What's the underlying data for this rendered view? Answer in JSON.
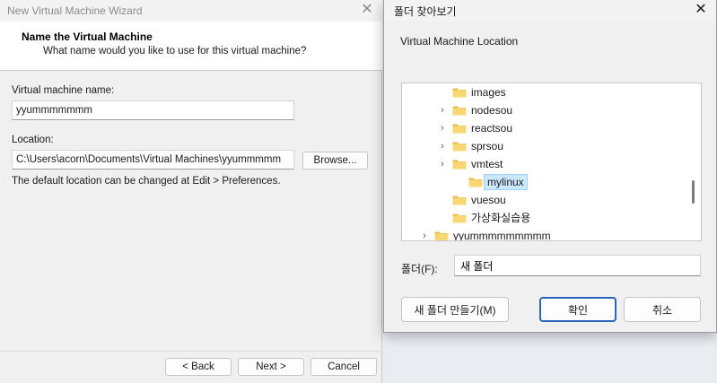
{
  "wizard": {
    "title": "New Virtual Machine Wizard",
    "close_glyph": "✕",
    "header_title": "Name the Virtual Machine",
    "header_subtitle": "What name would you like to use for this virtual machine?",
    "vm_name_label": "Virtual machine name:",
    "vm_name_value": "yyummmmmmm",
    "location_label": "Location:",
    "location_value": "C:\\Users\\acorn\\Documents\\Virtual Machines\\yyummmmm",
    "browse_label": "Browse...",
    "default_note": "The default location can be changed at Edit > Preferences.",
    "back_label": "< Back",
    "next_label": "Next >",
    "cancel_label": "Cancel"
  },
  "folder_dialog": {
    "title": "폴더 찾아보기",
    "close_glyph": "✕",
    "description": "Virtual Machine Location",
    "tree": [
      {
        "label": "images",
        "expandable": false,
        "level": 1,
        "selected": false
      },
      {
        "label": "nodesou",
        "expandable": true,
        "level": 1,
        "selected": false
      },
      {
        "label": "reactsou",
        "expandable": true,
        "level": 1,
        "selected": false
      },
      {
        "label": "sprsou",
        "expandable": true,
        "level": 1,
        "selected": false
      },
      {
        "label": "vmtest",
        "expandable": true,
        "level": 1,
        "selected": false
      },
      {
        "label": "mylinux",
        "expandable": false,
        "level": 2,
        "selected": true
      },
      {
        "label": "vuesou",
        "expandable": false,
        "level": 1,
        "selected": false
      },
      {
        "label": "가상화실습용",
        "expandable": false,
        "level": 1,
        "selected": false
      },
      {
        "label": "yyummmmmmmmm",
        "expandable": true,
        "level": 0,
        "selected": false
      }
    ],
    "folder_label": "폴더(F):",
    "folder_value": "새 폴더",
    "new_folder_label": "새 폴더 만들기(M)",
    "ok_label": "확인",
    "cancel_label": "취소"
  },
  "colors": {
    "folder_yellow": "#f8d775",
    "folder_yellow_dark": "#e6b94a",
    "selection": "#cce8ff",
    "primary_border": "#2b64b8"
  }
}
